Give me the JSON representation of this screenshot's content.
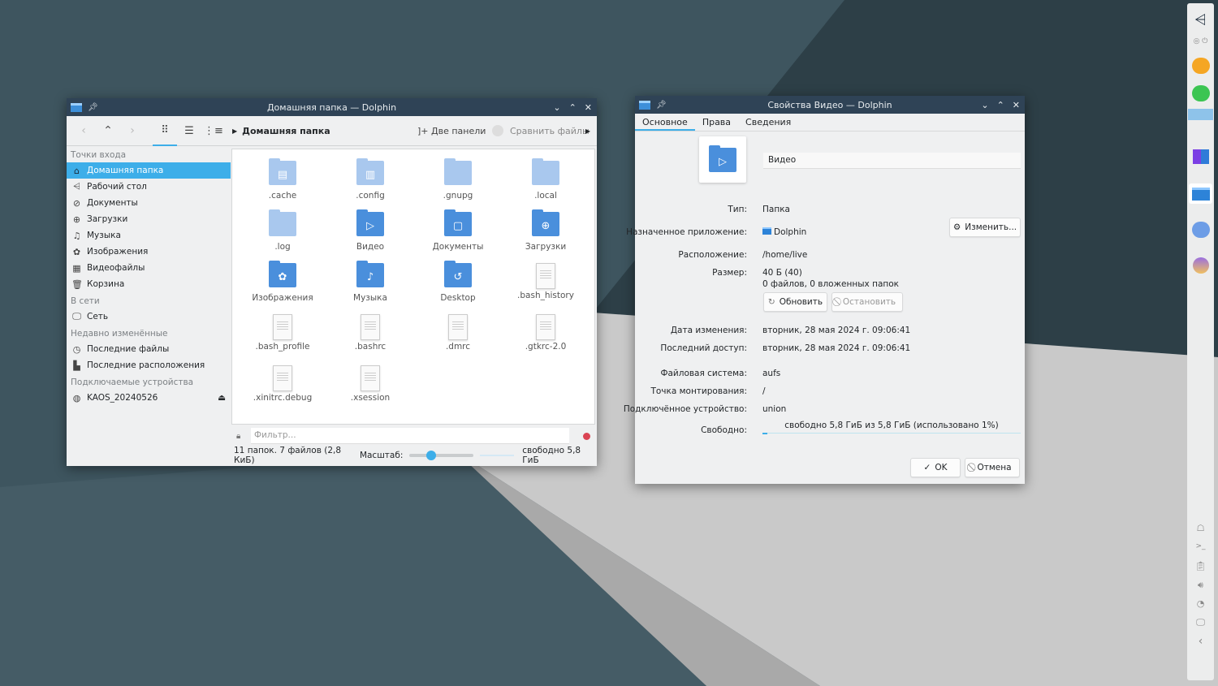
{
  "dolphin": {
    "title": "Домашняя папка — Dolphin",
    "toolbar": {
      "breadcrumb": "Домашняя папка",
      "split_label": "Две панели",
      "compare_label": "Сравнить файлы"
    },
    "sidebar": {
      "sections": [
        {
          "title": "Точки входа",
          "items": [
            {
              "label": "Домашняя папка",
              "icon": "home-icon",
              "selected": true
            },
            {
              "label": "Рабочий стол",
              "icon": "desktop-icon"
            },
            {
              "label": "Документы",
              "icon": "paperclip-icon"
            },
            {
              "label": "Загрузки",
              "icon": "download-icon"
            },
            {
              "label": "Музыка",
              "icon": "music-icon"
            },
            {
              "label": "Изображения",
              "icon": "image-icon"
            },
            {
              "label": "Видеофайлы",
              "icon": "film-icon"
            },
            {
              "label": "Корзина",
              "icon": "trash-icon"
            }
          ]
        },
        {
          "title": "В сети",
          "items": [
            {
              "label": "Сеть",
              "icon": "network-icon"
            }
          ]
        },
        {
          "title": "Недавно изменённые",
          "items": [
            {
              "label": "Последние файлы",
              "icon": "clock-icon"
            },
            {
              "label": "Последние расположения",
              "icon": "folder-clock-icon"
            }
          ]
        },
        {
          "title": "Подключаемые устройства",
          "items": [
            {
              "label": "KAOS_20240526",
              "icon": "disc-icon",
              "eject": true
            }
          ]
        }
      ]
    },
    "files": [
      {
        "name": ".cache",
        "type": "folder-light",
        "glyph": "▤"
      },
      {
        "name": ".config",
        "type": "folder-light",
        "glyph": "▥"
      },
      {
        "name": ".gnupg",
        "type": "folder-light",
        "glyph": ""
      },
      {
        "name": ".local",
        "type": "folder-light",
        "glyph": ""
      },
      {
        "name": ".log",
        "type": "folder-light",
        "glyph": ""
      },
      {
        "name": "Видео",
        "type": "folder",
        "glyph": "▷"
      },
      {
        "name": "Документы",
        "type": "folder",
        "glyph": "▢"
      },
      {
        "name": "Загрузки",
        "type": "folder",
        "glyph": "⊕"
      },
      {
        "name": "Изображения",
        "type": "folder",
        "glyph": "✿"
      },
      {
        "name": "Музыка",
        "type": "folder",
        "glyph": "♪"
      },
      {
        "name": "Desktop",
        "type": "folder",
        "glyph": "↺"
      },
      {
        "name": ".bash_history",
        "type": "doc"
      },
      {
        "name": ".bash_profile",
        "type": "doc"
      },
      {
        "name": ".bashrc",
        "type": "doc"
      },
      {
        "name": ".dmrc",
        "type": "doc"
      },
      {
        "name": ".gtkrc-2.0",
        "type": "doc"
      },
      {
        "name": ".xinitrc.debug",
        "type": "doc"
      },
      {
        "name": ".xsession",
        "type": "doc"
      }
    ],
    "filter_placeholder": "Фильтр...",
    "status": {
      "summary": "11 папок. 7 файлов (2,8 КиБ)",
      "zoom_label": "Масштаб:",
      "zoom_level": 0.3,
      "free": "свободно 5,8 ГиБ"
    }
  },
  "properties": {
    "title": "Свойства Видео — Dolphin",
    "tabs": [
      "Основное",
      "Права",
      "Сведения"
    ],
    "name_value": "Видео",
    "type_label": "Тип:",
    "type_value": "Папка",
    "app_label": "Назначенное приложение:",
    "app_value": "Dolphin",
    "change_button": "Изменить...",
    "location_label": "Расположение:",
    "location_value": "/home/live",
    "size_label": "Размер:",
    "size_value": "40 Б (40)",
    "size_detail": "0 файлов, 0 вложенных папок",
    "refresh_button": "Обновить",
    "stop_button": "Остановить",
    "modified_label": "Дата изменения:",
    "modified_value": "вторник, 28 мая 2024 г. 09:06:41",
    "accessed_label": "Последний доступ:",
    "accessed_value": "вторник, 28 мая 2024 г. 09:06:41",
    "fs_label": "Файловая система:",
    "fs_value": "aufs",
    "mount_label": "Точка монтирования:",
    "mount_value": "/",
    "device_label": "Подключённое устройство:",
    "device_value": "union",
    "free_label": "Свободно:",
    "free_value": "свободно 5,8 ГиБ из 5,8 ГиБ (использовано 1%)",
    "used_percent": 1,
    "ok_button": "OK",
    "cancel_button": "Отмена"
  },
  "colors": {
    "accent": "#3daee9",
    "titlebar": "#2f4356",
    "folder": "#4a8fdc",
    "folder_light": "#a9c8ee"
  }
}
